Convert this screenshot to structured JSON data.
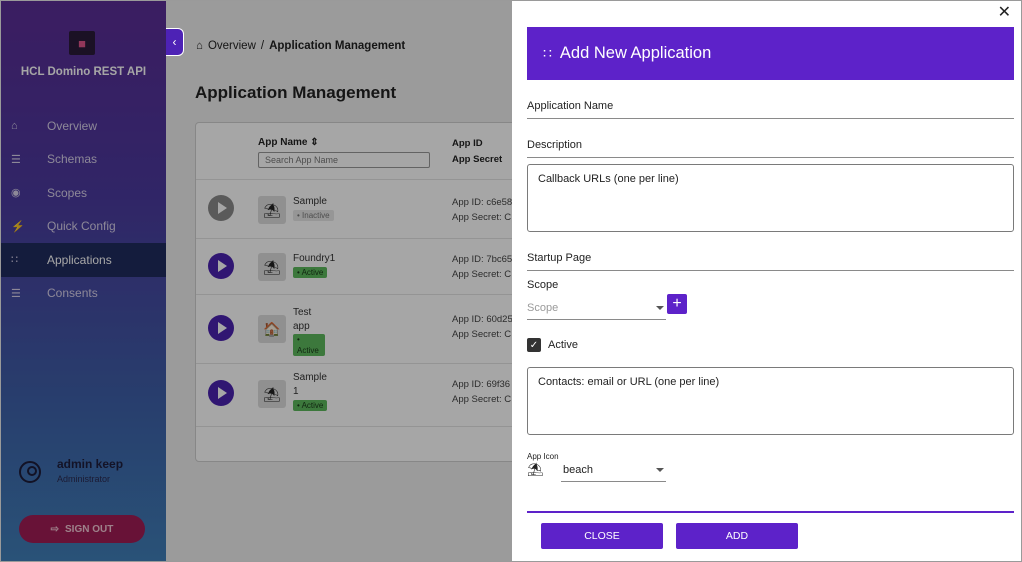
{
  "sidebar": {
    "app_name": "HCL Domino REST API",
    "items": [
      {
        "label": "Overview",
        "icon": "home-icon",
        "glyph": "⌂"
      },
      {
        "label": "Schemas",
        "icon": "list-icon",
        "glyph": "☰"
      },
      {
        "label": "Scopes",
        "icon": "target-icon",
        "glyph": "◉"
      },
      {
        "label": "Quick Config",
        "icon": "bolt-icon",
        "glyph": "⚡"
      },
      {
        "label": "Applications",
        "icon": "apps-grid-icon",
        "glyph": "∷"
      },
      {
        "label": "Consents",
        "icon": "checklist-icon",
        "glyph": "☰"
      }
    ],
    "active_item": "Applications",
    "user": {
      "name": "admin keep",
      "role": "Administrator"
    },
    "signout_label": "SIGN OUT"
  },
  "breadcrumb": {
    "home": "Overview",
    "separator": "/",
    "current": "Application Management"
  },
  "page": {
    "title": "Application Management"
  },
  "table": {
    "col_app_name": "App Name",
    "search_placeholder": "Search App Name",
    "col_app_id": "App ID",
    "col_app_secret": "App Secret",
    "rows": [
      {
        "name": "Sample",
        "status": "Inactive",
        "app_id": "App ID: c6e58",
        "secret": "App Secret: C"
      },
      {
        "name": "Foundry1",
        "status": "Active",
        "app_id": "App ID: 7bc65",
        "secret": "App Secret: C"
      },
      {
        "name": "Test app",
        "status": "Active",
        "app_id": "App ID: 60d25",
        "secret": "App Secret: C"
      },
      {
        "name": "Sample 1",
        "status": "Active",
        "app_id": "App ID: 69f36",
        "secret": "App Secret: C"
      }
    ]
  },
  "dialog": {
    "title": "Add New Application",
    "application_name_label": "Application Name",
    "description_label": "Description",
    "callback_placeholder": "Callback URLs (one per line)",
    "startup_page_label": "Startup Page",
    "scope_label": "Scope",
    "scope_placeholder": "Scope",
    "active_label": "Active",
    "active_checked": true,
    "contacts_placeholder": "Contacts: email or URL (one per line)",
    "app_icon_label": "App Icon",
    "app_icon_value": "beach",
    "close_label": "CLOSE",
    "add_label": "ADD"
  },
  "colors": {
    "accent": "#5d22c9",
    "sidebar_top": "#5b2d96",
    "sidebar_bottom": "#3f7fb8",
    "signout": "#a01c55"
  }
}
